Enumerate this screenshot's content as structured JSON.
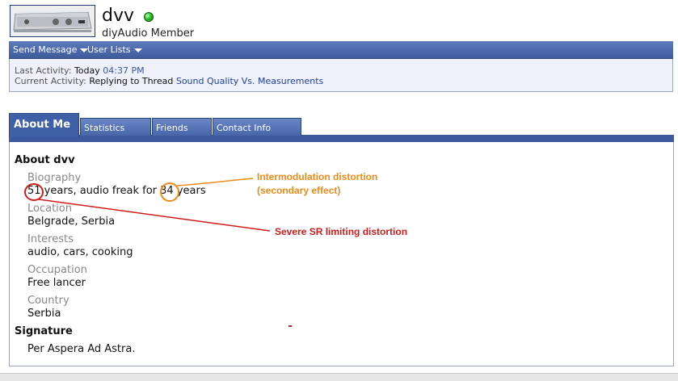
{
  "profile": {
    "username": "dvv",
    "user_title": "diyAudio Member",
    "online_status": "online",
    "status_color": "#2fc12f"
  },
  "toolbar": {
    "send_message": "Send Message",
    "user_lists": "User Lists"
  },
  "activity": {
    "last_label": "Last Activity:",
    "last_day": "Today",
    "last_time": "04:37 PM",
    "current_label": "Current Activity:",
    "current_text": "Replying to Thread",
    "current_link": "Sound Quality Vs. Measurements"
  },
  "tabs": [
    {
      "label": "About Me",
      "active": true
    },
    {
      "label": "Statistics",
      "active": false
    },
    {
      "label": "Friends",
      "active": false
    },
    {
      "label": "Contact Info",
      "active": false
    }
  ],
  "about": {
    "heading": "About dvv",
    "biography_label": "Biography",
    "biography_age": "51",
    "biography_mid": " years, audio freak for ",
    "biography_years": "34",
    "biography_end": " years",
    "location_label": "Location",
    "location_value": "Belgrade, Serbia",
    "interests_label": "Interests",
    "interests_value": "audio, cars, cooking",
    "occupation_label": "Occupation",
    "occupation_value": "Free lancer",
    "country_label": "Country",
    "country_value": "Serbia"
  },
  "signature": {
    "heading": "Signature",
    "text": "Per Aspera Ad Astra."
  },
  "annotations": {
    "intermod_line1": "Intermodulation distortion",
    "intermod_line2": "(secondary effect)",
    "severe": "Severe SR limiting distortion",
    "orange_color": "#f08a17",
    "red_color": "#d11b1b"
  }
}
